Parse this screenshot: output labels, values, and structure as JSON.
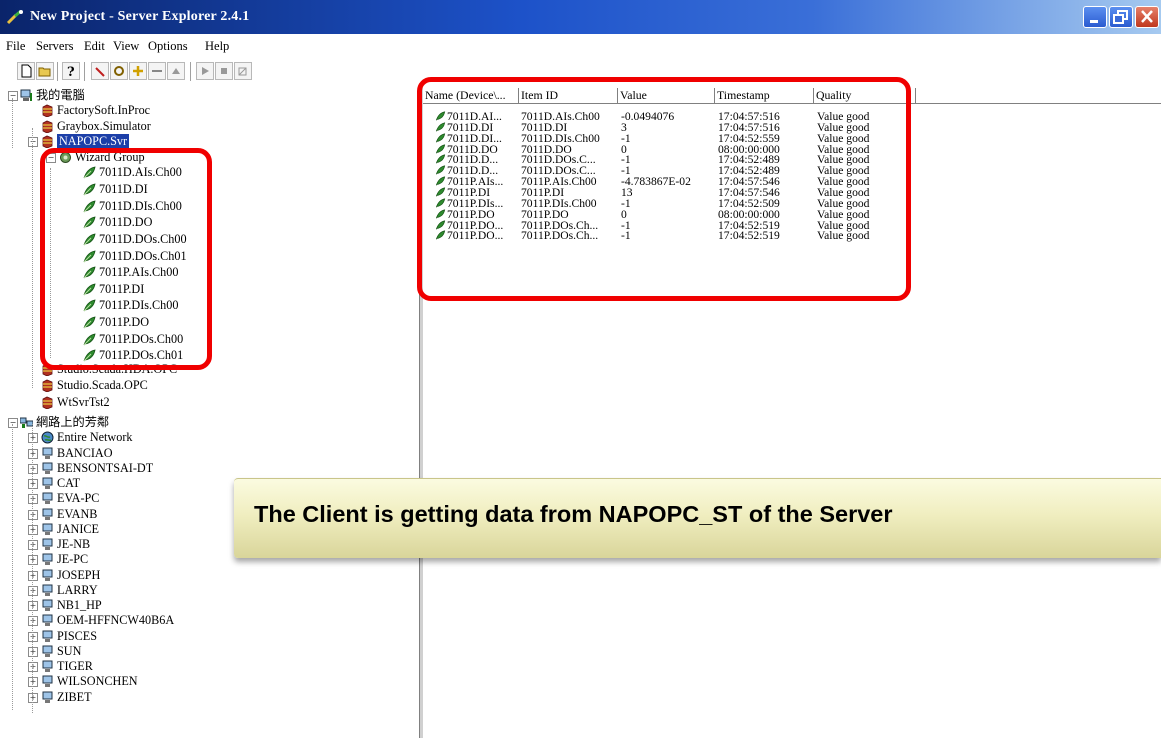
{
  "window": {
    "title": "New Project - Server Explorer 2.4.1"
  },
  "menu": [
    "File",
    "Servers",
    "Edit",
    "View",
    "Options",
    "Help"
  ],
  "toolbar": [
    "new-icon",
    "open-icon",
    "help-icon",
    "pointer-icon",
    "connect-icon",
    "add-item-icon",
    "remove-icon",
    "up-icon",
    "play-icon",
    "stop-icon",
    "write-icon"
  ],
  "tree": {
    "root_mycomputer": "我的電腦",
    "servers": [
      "FactorySoft.InProc",
      "Graybox.Simulator",
      "NAPOPC.Svr"
    ],
    "group": "Wizard Group",
    "items": [
      "7011D.AIs.Ch00",
      "7011D.DI",
      "7011D.DIs.Ch00",
      "7011D.DO",
      "7011D.DOs.Ch00",
      "7011D.DOs.Ch01",
      "7011P.AIs.Ch00",
      "7011P.DI",
      "7011P.DIs.Ch00",
      "7011P.DO",
      "7011P.DOs.Ch00",
      "7011P.DOs.Ch01"
    ],
    "servers_after": [
      "Studio.Scada.HDA.OPC",
      "Studio.Scada.OPC",
      "WtSvrTst2"
    ],
    "root_network": "網路上的芳鄰",
    "network_nodes": [
      "Entire Network",
      "BANCIAO",
      "BENSONTSAI-DT",
      "CAT",
      "EVA-PC",
      "EVANB",
      "JANICE",
      "JE-NB",
      "JE-PC",
      "JOSEPH",
      "LARRY",
      "NB1_HP",
      "OEM-HFFNCW40B6A",
      "PISCES",
      "SUN",
      "TIGER",
      "WILSONCHEN",
      "ZIBET"
    ]
  },
  "list": {
    "columns": [
      "Name (Device\\...",
      "Item ID",
      "Value",
      "Timestamp",
      "Quality"
    ],
    "rows": [
      [
        "7011D.AI...",
        "7011D.AIs.Ch00",
        "-0.0494076",
        "17:04:57:516",
        "Value good"
      ],
      [
        "7011D.DI",
        "7011D.DI",
        "3",
        "17:04:57:516",
        "Value good"
      ],
      [
        "7011D.DI...",
        "7011D.DIs.Ch00",
        "-1",
        "17:04:52:559",
        "Value good"
      ],
      [
        "7011D.DO",
        "7011D.DO",
        "0",
        "08:00:00:000",
        "Value good"
      ],
      [
        "7011D.D...",
        "7011D.DOs.C...",
        "-1",
        "17:04:52:489",
        "Value good"
      ],
      [
        "7011D.D...",
        "7011D.DOs.C...",
        "-1",
        "17:04:52:489",
        "Value good"
      ],
      [
        "7011P.AIs...",
        "7011P.AIs.Ch00",
        "-4.783867E-02",
        "17:04:57:546",
        "Value good"
      ],
      [
        "7011P.DI",
        "7011P.DI",
        "13",
        "17:04:57:546",
        "Value good"
      ],
      [
        "7011P.DIs...",
        "7011P.DIs.Ch00",
        "-1",
        "17:04:52:509",
        "Value good"
      ],
      [
        "7011P.DO",
        "7011P.DO",
        "0",
        "08:00:00:000",
        "Value good"
      ],
      [
        "7011P.DO...",
        "7011P.DOs.Ch...",
        "-1",
        "17:04:52:519",
        "Value good"
      ],
      [
        "7011P.DO...",
        "7011P.DOs.Ch...",
        "-1",
        "17:04:52:519",
        "Value good"
      ]
    ]
  },
  "caption": "The Client is getting data from NAPOPC_ST of the Server",
  "colors": {
    "highlight": "#f00000",
    "selection": "#1c3fa8",
    "leaf": "#2e8b2e"
  }
}
